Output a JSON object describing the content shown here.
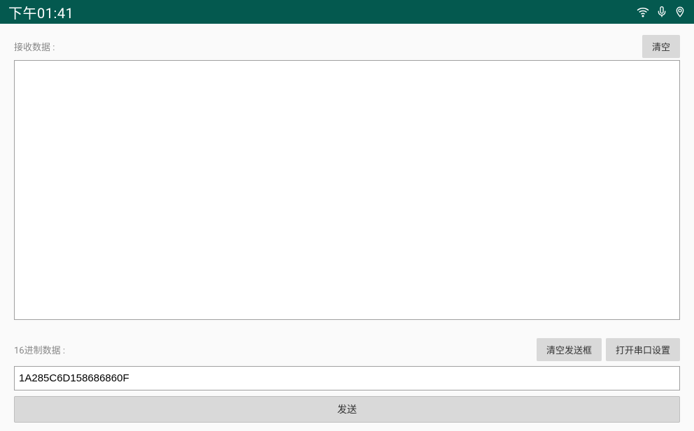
{
  "statusBar": {
    "time": "下午01:41"
  },
  "receiveSection": {
    "label": "接收数据 :",
    "clearBtn": "清空",
    "value": ""
  },
  "hexSection": {
    "label": "16进制数据 :",
    "clearSendBtn": "清空发送框",
    "openSerialBtn": "打开串口设置",
    "inputValue": "1A285C6D158686860F"
  },
  "sendBtn": "发送"
}
